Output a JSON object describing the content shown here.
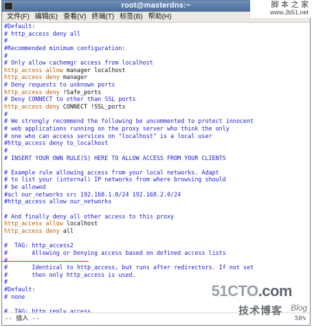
{
  "window": {
    "title": "root@masterdns:~"
  },
  "watermark_top": {
    "name": "脚 本 之 家",
    "url": "www.Jb51.net"
  },
  "menubar": {
    "items": [
      "文件(F)",
      "编辑(E)",
      "查看(V)",
      "终端(T)",
      "标签(B)",
      "帮助(H)"
    ]
  },
  "editor": {
    "lines": [
      [
        {
          "c": "c",
          "t": "#Default:"
        }
      ],
      [
        {
          "c": "c",
          "t": "# http_access deny all"
        }
      ],
      [
        {
          "c": "c",
          "t": "#"
        }
      ],
      [
        {
          "c": "c",
          "t": "#Recommended minimum configuration:"
        }
      ],
      [
        {
          "c": "c",
          "t": "#"
        }
      ],
      [
        {
          "c": "c",
          "t": "# Only allow cachemgr access from localhost"
        }
      ],
      [
        {
          "c": "k",
          "t": "http_access"
        },
        {
          "c": "t",
          "t": " "
        },
        {
          "c": "k",
          "t": "allow"
        },
        {
          "c": "t",
          "t": " manager localhost"
        }
      ],
      [
        {
          "c": "k",
          "t": "http_access"
        },
        {
          "c": "t",
          "t": " "
        },
        {
          "c": "k",
          "t": "deny"
        },
        {
          "c": "t",
          "t": " manager"
        }
      ],
      [
        {
          "c": "c",
          "t": "# Deny requests to unknown ports"
        }
      ],
      [
        {
          "c": "k",
          "t": "http_access"
        },
        {
          "c": "t",
          "t": " "
        },
        {
          "c": "k",
          "t": "deny"
        },
        {
          "c": "t",
          "t": " !Safe_ports"
        }
      ],
      [
        {
          "c": "c",
          "t": "# Deny CONNECT to other than SSL ports"
        }
      ],
      [
        {
          "c": "k",
          "t": "http_access"
        },
        {
          "c": "t",
          "t": " "
        },
        {
          "c": "k",
          "t": "deny"
        },
        {
          "c": "t",
          "t": " CONNECT !SSL_ports"
        }
      ],
      [
        {
          "c": "c",
          "t": "#"
        }
      ],
      [
        {
          "c": "c",
          "t": "# We strongly recommend the following be uncommented to protect innocent"
        }
      ],
      [
        {
          "c": "c",
          "t": "# web applications running on the proxy server who think the only"
        }
      ],
      [
        {
          "c": "c",
          "t": "# one who can access services on \"localhost\" is a local user"
        }
      ],
      [
        {
          "c": "c",
          "t": "#http_access deny to_localhost"
        }
      ],
      [
        {
          "c": "c",
          "t": "#"
        }
      ],
      [
        {
          "c": "c",
          "t": "# INSERT YOUR OWN RULE(S) HERE TO ALLOW ACCESS FROM YOUR CLIENTS"
        }
      ],
      [
        {
          "c": "c",
          "t": ""
        }
      ],
      [
        {
          "c": "c",
          "t": "# Example rule allowing access from your local networks. Adapt"
        }
      ],
      [
        {
          "c": "c",
          "t": "# to list your (internal) IP networks from where browsing should"
        }
      ],
      [
        {
          "c": "c",
          "t": "# be allowed"
        }
      ],
      [
        {
          "c": "c",
          "t": "#acl our_networks src 192.168.1.0/24 192.168.2.0/24"
        }
      ],
      [
        {
          "c": "c",
          "t": "#http_access allow our_networks"
        }
      ],
      [
        {
          "c": "c",
          "t": ""
        }
      ],
      [
        {
          "c": "c",
          "t": "# And finally deny all other access to this proxy"
        }
      ],
      [
        {
          "c": "k",
          "t": "http_access"
        },
        {
          "c": "t",
          "t": " "
        },
        {
          "c": "k",
          "t": "allow"
        },
        {
          "c": "t",
          "t": " localhost"
        }
      ],
      [
        {
          "c": "k",
          "t": "http_access"
        },
        {
          "c": "t",
          "t": " "
        },
        {
          "c": "k",
          "t": "deny"
        },
        {
          "c": "t",
          "t": " all"
        }
      ],
      [
        {
          "c": "c",
          "t": ""
        }
      ],
      [
        {
          "c": "c",
          "t": "#  TAG: http_access2"
        }
      ],
      [
        {
          "c": "c",
          "t": "#       Allowing or Denying access based on defined access lists"
        }
      ],
      [
        {
          "c": "c",
          "t": "#"
        }
      ],
      [
        {
          "c": "c",
          "t": "#       Identical to http_access, but runs after redirectors. If not set"
        }
      ],
      [
        {
          "c": "c",
          "t": "#       then only http_access is used."
        }
      ],
      [
        {
          "c": "c",
          "t": "#"
        }
      ],
      [
        {
          "c": "c",
          "t": "#Default:"
        }
      ],
      [
        {
          "c": "c",
          "t": "# none"
        }
      ],
      [
        {
          "c": "c",
          "t": ""
        }
      ],
      [
        {
          "c": "c",
          "t": "#  TAG: http_reply_access"
        }
      ]
    ]
  },
  "statusbar": {
    "mode": "-- 插入 --",
    "percent": "58%"
  },
  "watermark_bottom": {
    "brand": "51CTO",
    "brand_suffix": ".com",
    "sub": "技术博客",
    "blog": "Blog"
  }
}
